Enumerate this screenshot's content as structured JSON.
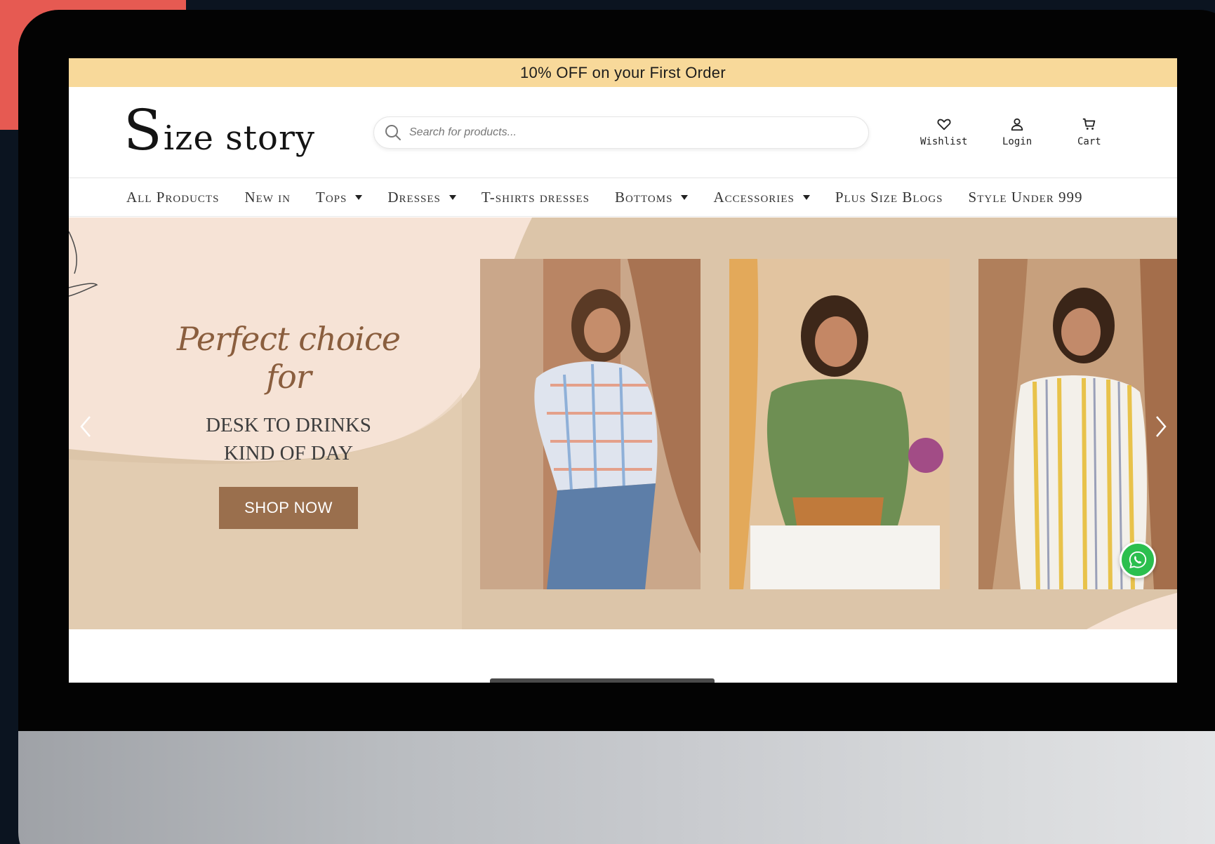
{
  "promo": {
    "text": "10% OFF on your First Order"
  },
  "brand": {
    "logo_s": "S",
    "logo_rest": "ize story"
  },
  "search": {
    "placeholder": "Search for products..."
  },
  "header_actions": {
    "wishlist": "Wishlist",
    "login": "Login",
    "cart": "Cart"
  },
  "nav": {
    "items": [
      {
        "label": "All Products",
        "has_dropdown": false
      },
      {
        "label": "New in",
        "has_dropdown": false
      },
      {
        "label": "Tops",
        "has_dropdown": true
      },
      {
        "label": "Dresses",
        "has_dropdown": true
      },
      {
        "label": "T-shirts dresses",
        "has_dropdown": false
      },
      {
        "label": "Bottoms",
        "has_dropdown": true
      },
      {
        "label": "Accessories",
        "has_dropdown": true
      },
      {
        "label": "Plus Size Blogs",
        "has_dropdown": false
      },
      {
        "label": "Style Under 999",
        "has_dropdown": false
      }
    ]
  },
  "hero": {
    "script": "Perfect choice for",
    "line1": "DESK TO DRINKS",
    "line2": "KIND OF DAY",
    "cta": "SHOP NOW"
  },
  "colors": {
    "promo_bar": "#f8d99a",
    "cta": "#9a6f4d",
    "accent_corner": "#e65a52",
    "whatsapp": "#2bbf4e"
  },
  "icons": [
    "search-icon",
    "heart-icon",
    "user-icon",
    "cart-icon",
    "chevron-left-icon",
    "chevron-right-icon",
    "whatsapp-icon"
  ]
}
